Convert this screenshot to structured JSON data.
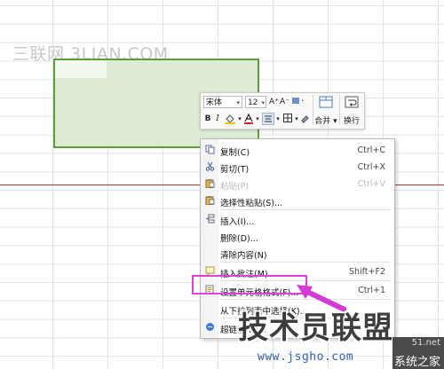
{
  "watermark_top": "三联网 3LIAN.COM",
  "mini_toolbar": {
    "font_name": "宋体",
    "font_size": "12",
    "grow_font": "A⁺",
    "shrink_font": "A⁻",
    "bold": "B",
    "italic": "I",
    "merge_label": "合并",
    "wrap_label": "换行"
  },
  "context_menu": {
    "items": [
      {
        "icon": "copy-icon",
        "label": "复制(C)",
        "shortcut": "Ctrl+C"
      },
      {
        "icon": "cut-icon",
        "label": "剪切(T)",
        "shortcut": "Ctrl+X"
      },
      {
        "icon": "paste-icon",
        "label": "粘贴(P)",
        "shortcut": "Ctrl+V"
      },
      {
        "icon": "paste-special-icon",
        "label": "选择性粘贴(S)...",
        "shortcut": ""
      },
      {
        "icon": "insert-icon",
        "label": "插入(I)...",
        "shortcut": ""
      },
      {
        "icon": "",
        "label": "删除(D)...",
        "shortcut": ""
      },
      {
        "icon": "",
        "label": "清除内容(N)",
        "shortcut": ""
      },
      {
        "icon": "comment-icon",
        "label": "插入批注(M)...",
        "shortcut": "Shift+F2"
      },
      {
        "icon": "format-cells-icon",
        "label": "设置单元格格式(F)...",
        "shortcut": "Ctrl+1"
      },
      {
        "icon": "",
        "label": "从下拉列表中选择(K)...",
        "shortcut": ""
      },
      {
        "icon": "hyperlink-icon",
        "label": "超链接(H)...",
        "shortcut": ""
      }
    ]
  },
  "highlight_color": "#e040e0",
  "brand_text": "技术员联盟",
  "brand_url": "www.jsgho.com",
  "corner_badge": {
    "line1": "51.net",
    "line2": "系统之家"
  }
}
